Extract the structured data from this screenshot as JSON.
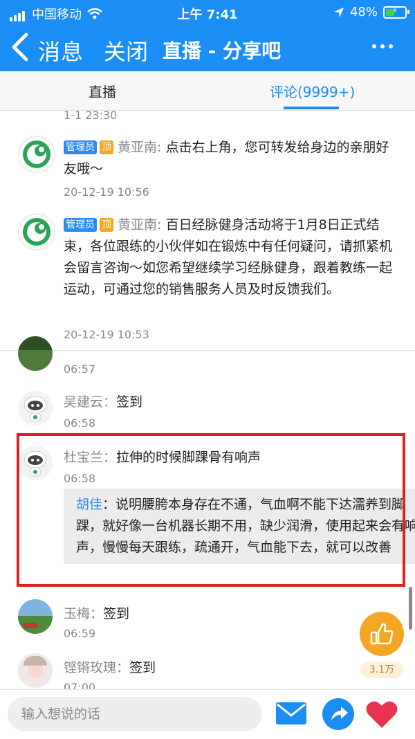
{
  "status": {
    "carrier": "中国移动",
    "time": "上午 7:41",
    "battery": "48%",
    "carrier_icon": "signal-bars-icon",
    "wifi_icon": "wifi-icon",
    "location_icon": "location-arrow-icon",
    "battery_icon": "battery-charging-icon"
  },
  "nav": {
    "back": "消息",
    "close": "关闭",
    "title": "直播 - 分享吧",
    "more_icon": "more-dots-icon"
  },
  "tabs": [
    {
      "label": "直播",
      "active": false
    },
    {
      "label": "评论(9999+)",
      "active": true
    }
  ],
  "pinned": [
    {
      "admin_badge": "管理员",
      "top_badge": "顶",
      "name": "黄亚南:",
      "text": "点击右上角，您可转发给身边的亲朋好友哦～",
      "time": "20-12-19 10:56"
    },
    {
      "admin_badge": "管理员",
      "top_badge": "顶",
      "name": "黄亚南:",
      "text": "百日经脉健身活动将于1月8日正式结束，各位跟练的小伙伴如在锻炼中有任何疑问，请抓紧机会留言咨询～如您希望继续学习经脉健身，跟着教练一起运动，可通过您的销售服务人员及时反馈我们。",
      "time": "20-12-19 10:53"
    }
  ],
  "top_cut_time": "1-1 23:30",
  "comments": [
    {
      "name": "",
      "text": "",
      "time": "06:57"
    },
    {
      "name": "吴建云",
      "sep": "：",
      "text": "签到",
      "time": "06:58"
    },
    {
      "name": "杜宝兰",
      "sep": "：",
      "text": "拉伸的时候脚踝骨有响声",
      "time": "06:58",
      "reply": {
        "name": "胡佳",
        "sep": "：",
        "text": "说明腰胯本身存在不通，气血啊不能下达濡养到脚踝，就好像一台机器长期不用，缺少润滑，使用起来会有响声，慢慢每天跟练，疏通开，气血能下去，就可以改善"
      }
    },
    {
      "name": "玉梅",
      "sep": "：",
      "text": "签到",
      "time": "06:59"
    },
    {
      "name": "铿锵玫瑰",
      "sep": "：",
      "text": "签到",
      "time": "07:00"
    }
  ],
  "like": {
    "count": "3.1万",
    "icon": "thumbs-up-icon"
  },
  "bottom": {
    "placeholder": "输入想说的话",
    "mail_icon": "mail-icon",
    "share_icon": "share-icon",
    "heart_icon": "heart-icon"
  },
  "colors": {
    "brand": "#1a8ef5",
    "highlight": "#e02020",
    "like": "#f5a623",
    "heart": "#e8344e"
  }
}
